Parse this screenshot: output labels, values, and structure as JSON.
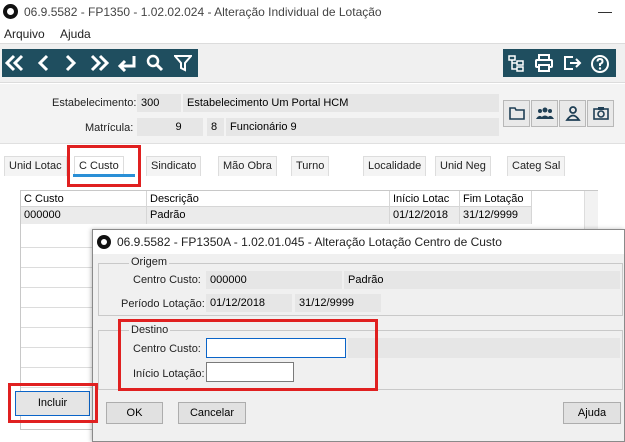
{
  "window": {
    "title": "06.9.5582 - FP1350 - 1.02.02.024 - Alteração Individual de Lotação",
    "minimize": "—"
  },
  "menu": {
    "items": [
      "Arquivo",
      "Ajuda"
    ]
  },
  "toolbar": {
    "nav_icons": [
      "first-icon",
      "previous-icon",
      "next-icon",
      "last-icon",
      "return-icon",
      "search-icon",
      "filter-icon"
    ],
    "right_icons": [
      "org-chart-icon",
      "print-icon",
      "exit-icon",
      "help-icon"
    ]
  },
  "header": {
    "estabelecimento_label": "Estabelecimento:",
    "estabelecimento_code": "300",
    "estabelecimento_name": "Estabelecimento Um Portal HCM",
    "matricula_label": "Matrícula:",
    "matricula_value": "9",
    "funcionario_code": "8",
    "funcionario_name": "Funcionário 9"
  },
  "side_buttons": [
    "folder-icon",
    "group-icon",
    "person-icon",
    "camera-icon"
  ],
  "tabs": [
    "Unid Lotac",
    "C Custo",
    "Sindicato",
    "Mão Obra",
    "Turno",
    "Localidade",
    "Unid Neg",
    "Categ Sal"
  ],
  "active_tab": "C Custo",
  "grid": {
    "columns": [
      "C Custo",
      "Descrição",
      "Início Lotac",
      "Fim Lotação"
    ],
    "rows": [
      [
        "000000",
        "Padrão",
        "01/12/2018",
        "31/12/9999"
      ]
    ]
  },
  "incluir_label": "Incluir",
  "dialog": {
    "title": "06.9.5582 - FP1350A - 1.02.01.045 - Alteração Lotação Centro de Custo",
    "origem": {
      "title": "Origem",
      "centro_custo_label": "Centro Custo:",
      "centro_custo_code": "000000",
      "centro_custo_desc": "Padrão",
      "periodo_label": "Período Lotação:",
      "periodo_inicio": "01/12/2018",
      "periodo_fim": "31/12/9999"
    },
    "destino": {
      "title": "Destino",
      "centro_custo_label": "Centro Custo:",
      "centro_custo_value": "",
      "inicio_label": "Início Lotação:",
      "inicio_value": ""
    },
    "buttons": {
      "ok": "OK",
      "cancelar": "Cancelar",
      "ajuda": "Ajuda"
    }
  },
  "colors": {
    "toolbar_dark": "#1f4e5f",
    "highlight_red": "#e02020",
    "tab_underline": "#2a8fd6"
  }
}
